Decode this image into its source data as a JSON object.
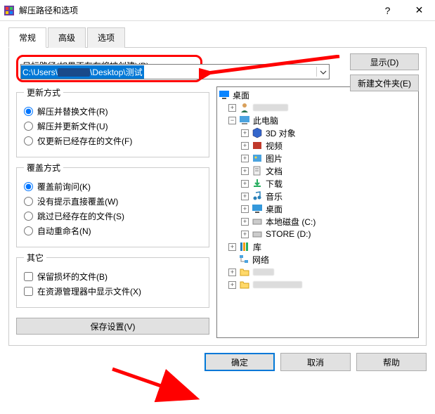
{
  "window": {
    "title": "解压路径和选项"
  },
  "tabs": {
    "general": "常规",
    "advanced": "高级",
    "options": "选项"
  },
  "path": {
    "label": "目标路径(如果不存在将被创建)(P)",
    "value_prefix": "C:\\Users\\",
    "value_suffix": "\\Desktop\\测试"
  },
  "buttons": {
    "display": "显示(D)",
    "newfolder": "新建文件夹(E)",
    "save_settings": "保存设置(V)",
    "ok": "确定",
    "cancel": "取消",
    "help": "帮助"
  },
  "groups": {
    "update_mode": "更新方式",
    "overwrite_mode": "覆盖方式",
    "misc": "其它"
  },
  "update": {
    "replace": "解压并替换文件(R)",
    "update": "解压并更新文件(U)",
    "existing": "仅更新已经存在的文件(F)"
  },
  "overwrite": {
    "ask": "覆盖前询问(K)",
    "noprompt": "没有提示直接覆盖(W)",
    "skip": "跳过已经存在的文件(S)",
    "rename": "自动重命名(N)"
  },
  "misc": {
    "keep_broken": "保留损坏的文件(B)",
    "show_explorer": "在资源管理器中显示文件(X)"
  },
  "tree": {
    "desktop": "桌面",
    "this_pc": "此电脑",
    "objects3d": "3D 对象",
    "videos": "视频",
    "pictures": "图片",
    "documents": "文档",
    "downloads": "下载",
    "music": "音乐",
    "desktop2": "桌面",
    "disk_c": "本地磁盘 (C:)",
    "disk_d": "STORE (D:)",
    "libraries": "库",
    "network": "网络"
  }
}
